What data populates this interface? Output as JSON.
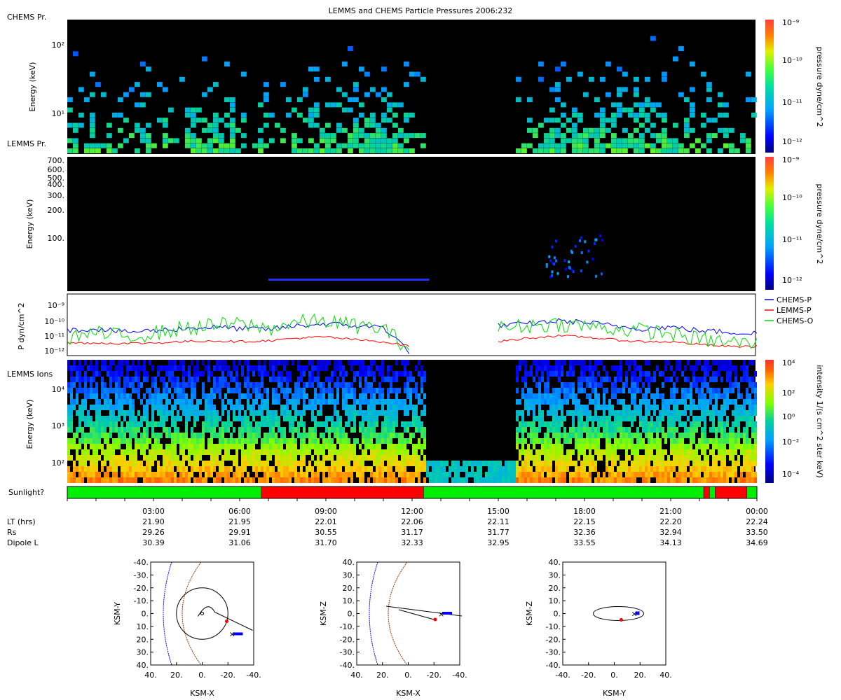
{
  "title": "LEMMS and CHEMS Particle Pressures  2006:232",
  "colors": {
    "chems_p": "#0000ff",
    "lemms_p": "#ff0000",
    "chems_o": "#00e000",
    "sun": "#00ee00",
    "shadow": "#ff0000",
    "spacecraft": "#ff0000",
    "bowshock": "#0000ff",
    "magnetopause": "#993300"
  },
  "panels": {
    "chems": {
      "label": "CHEMS Pr.",
      "ylabel": "Energy (keV)",
      "ytick_labels": [
        "10²",
        "10¹"
      ],
      "yscale": "log",
      "ylim": [
        3,
        220
      ]
    },
    "lemms_pr": {
      "label": "LEMMS Pr.",
      "ylabel": "Energy (keV)",
      "ytick_labels": [
        "700.",
        "600.",
        "500.",
        "400.",
        "300.",
        "200.",
        "100."
      ],
      "yscale": "log",
      "ylim": [
        25,
        740
      ]
    },
    "pressure": {
      "ylabel": "P dyn/cm^2",
      "ytick_labels": [
        "10⁻⁹",
        "10⁻¹⁰",
        "10⁻¹¹",
        "10⁻¹²"
      ],
      "yscale": "log",
      "ylim": [
        "4e-13",
        "3e-9"
      ]
    },
    "lemms_ions": {
      "label": "LEMMS Ions",
      "ylabel": "Energy (keV)",
      "ytick_labels": [
        "10⁴",
        "10³",
        "10²"
      ],
      "yscale": "log",
      "ylim": [
        25,
        80000
      ]
    },
    "sunlight": {
      "label": "Sunlight?"
    }
  },
  "colorbars": {
    "pressure_top": {
      "label": "pressure dyne/cm^2",
      "tick_labels": [
        "10⁻⁹",
        "10⁻¹⁰",
        "10⁻¹¹",
        "10⁻¹²"
      ]
    },
    "pressure_mid": {
      "label": "pressure dyne/cm^2",
      "tick_labels": [
        "10⁻⁹",
        "10⁻¹⁰",
        "10⁻¹¹",
        "10⁻¹²"
      ]
    },
    "intensity": {
      "label": "intensity 1/(s cm^2 ster keV)",
      "tick_labels": [
        "10⁴",
        "10²",
        "10⁰",
        "10⁻²",
        "10⁻⁴"
      ]
    }
  },
  "time_axis": {
    "tick_labels": [
      "03:00",
      "06:00",
      "09:00",
      "12:00",
      "15:00",
      "18:00",
      "21:00",
      "00:00"
    ],
    "rows": [
      {
        "label": "LT (hrs)",
        "values": [
          "21.90",
          "21.95",
          "22.01",
          "22.06",
          "22.11",
          "22.15",
          "22.20",
          "22.24"
        ]
      },
      {
        "label": "Rs",
        "values": [
          "29.26",
          "29.91",
          "30.55",
          "31.17",
          "31.77",
          "32.36",
          "32.94",
          "33.50"
        ]
      },
      {
        "label": "Dipole L",
        "values": [
          "30.39",
          "31.06",
          "31.70",
          "32.33",
          "32.95",
          "33.55",
          "34.13",
          "34.69"
        ]
      }
    ]
  },
  "orbits": [
    {
      "xlabel": "KSM-X",
      "ylabel": "KSM-Y",
      "x_tick_labels": [
        "40.",
        "20.",
        "0.",
        "-20.",
        "-40."
      ],
      "y_tick_labels": [
        "-40.",
        "-30.",
        "-20.",
        "-10.",
        "0.",
        "10.",
        "20.",
        "30.",
        "40."
      ]
    },
    {
      "xlabel": "KSM-X",
      "ylabel": "KSM-Z",
      "x_tick_labels": [
        "40.",
        "20.",
        "0.",
        "-20.",
        "-40."
      ],
      "y_tick_labels": [
        "40.",
        "30.",
        "20.",
        "10.",
        "0.",
        "-10.",
        "-20.",
        "-30.",
        "-40."
      ]
    },
    {
      "xlabel": "KSM-Y",
      "ylabel": "KSM-Z",
      "x_tick_labels": [
        "-40.",
        "-20.",
        "0.",
        "20.",
        "40."
      ],
      "y_tick_labels": [
        "40.",
        "30.",
        "20.",
        "10.",
        "0.",
        "-10.",
        "-20.",
        "-30.",
        "-40."
      ]
    }
  ],
  "chart_data": {
    "type": "line",
    "title": "LEMMS and CHEMS Particle Pressures  2006:232",
    "xlabel": "",
    "ylabel": "P dyn/cm^2",
    "x_unit": "hours of 2006:232 (UT)",
    "xlim": [
      0,
      24
    ],
    "yscale": "log",
    "ylim": [
      "4e-13",
      "3e-9"
    ],
    "x": [
      0,
      1,
      2,
      3,
      4,
      5,
      6,
      7,
      8,
      9,
      10,
      11,
      12,
      13,
      14,
      15,
      16,
      17,
      18,
      19,
      20,
      21,
      22,
      23,
      24
    ],
    "series": [
      {
        "name": "CHEMS-P",
        "values": [
          "1.5e-11",
          "2e-11",
          "1.2e-11",
          "1.5e-11",
          "2e-11",
          "2.5e-11",
          "2e-11",
          "1.8e-11",
          "3e-11",
          "4e-11",
          "3e-11",
          "2.5e-11",
          "5e-13",
          null,
          null,
          "3e-11",
          "4e-11",
          "6e-11",
          "5e-11",
          "3e-11",
          "2e-11",
          "2.5e-11",
          "1.5e-11",
          "1.2e-11",
          "1e-11"
        ]
      },
      {
        "name": "LEMMS-P",
        "values": [
          "2.5e-12",
          "2.5e-12",
          "2.3e-12",
          "2.5e-12",
          "3e-12",
          "3.5e-12",
          "3e-12",
          "3.5e-12",
          "5e-12",
          "6e-12",
          "4e-12",
          "3e-12",
          "1.5e-12",
          null,
          null,
          "3e-12",
          "5e-12",
          "7e-12",
          "6e-12",
          "4e-12",
          "3e-12",
          "3e-12",
          "2e-12",
          "1.5e-12",
          "1.5e-12"
        ]
      },
      {
        "name": "CHEMS-O",
        "values": [
          "6e-12",
          "1e-11",
          "6e-12",
          "1e-11",
          "2e-11",
          "3e-11",
          "4e-11",
          "2e-11",
          "5e-11",
          "6e-11",
          "3e-11",
          "2e-11",
          "8e-13",
          null,
          null,
          "2e-11",
          "3e-11",
          "4e-11",
          "3e-11",
          "2e-11",
          "1.5e-11",
          "1e-11",
          "4e-12",
          "3e-12",
          "2e-12"
        ]
      }
    ],
    "sunlight": [
      {
        "state": "sunlit",
        "start": 0,
        "end": 6.75
      },
      {
        "state": "shadow",
        "start": 6.75,
        "end": 12.4
      },
      {
        "state": "sunlit",
        "start": 12.4,
        "end": 22.15
      },
      {
        "state": "shadow",
        "start": 22.15,
        "end": 22.35
      },
      {
        "state": "sunlit",
        "start": 22.35,
        "end": 22.55
      },
      {
        "state": "shadow",
        "start": 22.55,
        "end": 23.65
      },
      {
        "state": "sunlit",
        "start": 23.65,
        "end": 24
      }
    ]
  }
}
